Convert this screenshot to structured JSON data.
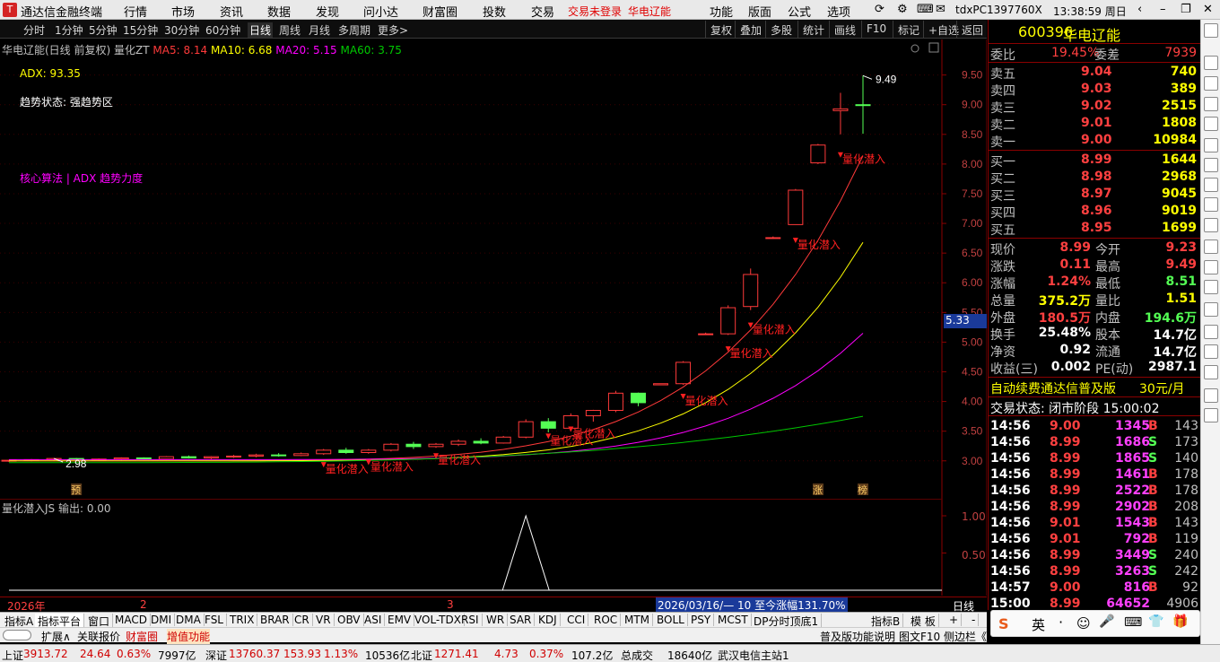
{
  "titlebar": {
    "app_name": "通达信金融终端",
    "menus": [
      "行情",
      "市场",
      "资讯",
      "数据",
      "发现",
      "问小达",
      "财富圈",
      "投数",
      "交易"
    ],
    "login_status": "交易未登录",
    "stock_name": "华电辽能",
    "menus2": [
      "功能",
      "版面",
      "公式",
      "选项"
    ],
    "pc_id": "tdxPC1397760X",
    "clock": "13:38:59 周日"
  },
  "periods": [
    "分时",
    "1分钟",
    "5分钟",
    "15分钟",
    "30分钟",
    "60分钟",
    "日线",
    "周线",
    "月线",
    "多周期",
    "更多>"
  ],
  "active_period": "日线",
  "tools": [
    "复权",
    "叠加",
    "多股",
    "统计",
    "画线",
    "F10",
    "标记",
    "+自选",
    "返回"
  ],
  "chart_header": {
    "title": "华电辽能(日线 前复权)",
    "indicator_name": "量化ZT",
    "ma5": "MA5: 8.14",
    "ma10": "MA10: 6.68",
    "ma20": "MA20: 5.15",
    "ma60": "MA60: 3.75"
  },
  "annotations": {
    "adx": "ADX: 93.35",
    "trend": "趋势状态: 强趋势区",
    "algo": "核心算法 | ADX 趋势力度"
  },
  "price_axis": [
    "9.50",
    "9.00",
    "8.50",
    "8.00",
    "7.50",
    "7.00",
    "6.50",
    "6.00",
    "5.50",
    "5.00",
    "4.50",
    "4.00",
    "3.50",
    "3.00"
  ],
  "current_price_marker": "5.33",
  "chart_labels": {
    "high": "9.49",
    "low": "2.98",
    "signal": "量化潜入",
    "badges": [
      "预",
      "涨",
      "榜"
    ]
  },
  "indicator": {
    "header": "量化潜入JS 输出: 0.00",
    "ticks": [
      "1.00",
      "0.50"
    ]
  },
  "xaxis": {
    "labels": [
      "2026年",
      "2",
      "3"
    ],
    "info": "2026/03/16/— 10 至今涨幅131.70%",
    "period": "日线"
  },
  "chart_data": {
    "type": "candlestick",
    "series": [
      {
        "name": "K线",
        "candles": [
          [
            3.0,
            3.02,
            2.98,
            3.01
          ],
          [
            3.01,
            3.03,
            2.99,
            3.02
          ],
          [
            3.02,
            3.05,
            3.0,
            3.04
          ],
          [
            3.04,
            3.05,
            3.01,
            3.02
          ],
          [
            3.02,
            3.04,
            3.0,
            3.03
          ],
          [
            3.03,
            3.06,
            3.01,
            3.05
          ],
          [
            3.05,
            3.06,
            3.02,
            3.03
          ],
          [
            3.03,
            3.08,
            3.02,
            3.07
          ],
          [
            3.07,
            3.09,
            3.04,
            3.05
          ],
          [
            3.05,
            3.08,
            3.03,
            3.07
          ],
          [
            3.07,
            3.1,
            3.05,
            3.08
          ],
          [
            3.08,
            3.12,
            3.06,
            3.1
          ],
          [
            3.1,
            3.13,
            3.07,
            3.09
          ],
          [
            3.09,
            3.14,
            3.08,
            3.12
          ],
          [
            3.12,
            3.2,
            3.1,
            3.18
          ],
          [
            3.18,
            3.22,
            3.12,
            3.14
          ],
          [
            3.14,
            3.2,
            3.12,
            3.18
          ],
          [
            3.18,
            3.3,
            3.16,
            3.28
          ],
          [
            3.28,
            3.32,
            3.2,
            3.24
          ],
          [
            3.24,
            3.3,
            3.22,
            3.28
          ],
          [
            3.28,
            3.36,
            3.25,
            3.33
          ],
          [
            3.33,
            3.38,
            3.28,
            3.3
          ],
          [
            3.3,
            3.42,
            3.29,
            3.4
          ],
          [
            3.4,
            3.7,
            3.38,
            3.66
          ],
          [
            3.66,
            3.72,
            3.48,
            3.55
          ],
          [
            3.55,
            3.8,
            3.52,
            3.76
          ],
          [
            3.76,
            3.86,
            3.66,
            3.85
          ],
          [
            3.85,
            4.18,
            3.82,
            4.14
          ],
          [
            4.14,
            4.15,
            3.92,
            3.98
          ],
          [
            4.28,
            4.3,
            4.28,
            4.3
          ],
          [
            4.3,
            4.68,
            4.28,
            4.66
          ],
          [
            5.13,
            5.16,
            5.12,
            5.14
          ],
          [
            5.14,
            5.62,
            5.12,
            5.58
          ],
          [
            5.6,
            6.24,
            5.54,
            6.14
          ],
          [
            6.76,
            6.78,
            6.74,
            6.76
          ],
          [
            6.98,
            7.58,
            6.98,
            7.56
          ],
          [
            8.02,
            8.34,
            8.0,
            8.32
          ],
          [
            8.9,
            9.2,
            8.5,
            8.93
          ],
          [
            9.0,
            9.49,
            8.51,
            8.99
          ]
        ]
      },
      {
        "name": "MA5",
        "values": [
          8.14
        ]
      },
      {
        "name": "MA10",
        "values": [
          6.68
        ]
      },
      {
        "name": "MA20",
        "values": [
          5.15
        ]
      },
      {
        "name": "MA60",
        "values": [
          3.75
        ]
      }
    ],
    "ylim": [
      2.8,
      9.6
    ],
    "ytick_labels": [
      "9.50",
      "9.00",
      "8.50",
      "8.00",
      "7.50",
      "7.00",
      "6.50",
      "6.00",
      "5.50",
      "5.00",
      "4.50",
      "4.00",
      "3.50",
      "3.00"
    ],
    "xtick_labels": [
      "2026年",
      "2",
      "3"
    ],
    "signals": [
      {
        "label": "量化潜入",
        "price": 9.49
      },
      {
        "label": "量化潜入",
        "price": 2.98
      }
    ]
  },
  "quote": {
    "code": "600396",
    "name": "华电辽能",
    "weibi_label": "委比",
    "weibi": "19.45%",
    "weicha_label": "委差",
    "weicha": "7939",
    "asks": [
      {
        "label": "卖五",
        "price": "9.04",
        "vol": "740"
      },
      {
        "label": "卖四",
        "price": "9.03",
        "vol": "389"
      },
      {
        "label": "卖三",
        "price": "9.02",
        "vol": "2515"
      },
      {
        "label": "卖二",
        "price": "9.01",
        "vol": "1808"
      },
      {
        "label": "卖一",
        "price": "9.00",
        "vol": "10984"
      }
    ],
    "bids": [
      {
        "label": "买一",
        "price": "8.99",
        "vol": "1644"
      },
      {
        "label": "买二",
        "price": "8.98",
        "vol": "2968"
      },
      {
        "label": "买三",
        "price": "8.97",
        "vol": "9045"
      },
      {
        "label": "买四",
        "price": "8.96",
        "vol": "9019"
      },
      {
        "label": "买五",
        "price": "8.95",
        "vol": "1699"
      }
    ],
    "stats": [
      [
        "现价",
        "8.99",
        "今开",
        "9.23"
      ],
      [
        "涨跌",
        "0.11",
        "最高",
        "9.49"
      ],
      [
        "涨幅",
        "1.24%",
        "最低",
        "8.51"
      ],
      [
        "总量",
        "375.2万",
        "量比",
        "1.51"
      ],
      [
        "外盘",
        "180.5万",
        "内盘",
        "194.6万"
      ],
      [
        "换手",
        "25.48%",
        "股本",
        "14.7亿"
      ],
      [
        "净资",
        "0.92",
        "流通",
        "14.7亿"
      ],
      [
        "收益(三)",
        "0.002",
        "PE(动)",
        "2987.1"
      ]
    ],
    "promo": "自动续费通达信普及版",
    "promo_price": "30元/月",
    "trade_status": "交易状态: 闭市阶段 15:00:02",
    "ticks": [
      [
        "14:56",
        "9.00",
        "1345",
        "B",
        "143"
      ],
      [
        "14:56",
        "8.99",
        "1686",
        "S",
        "173"
      ],
      [
        "14:56",
        "8.99",
        "1865",
        "S",
        "140"
      ],
      [
        "14:56",
        "8.99",
        "1461",
        "B",
        "178"
      ],
      [
        "14:56",
        "8.99",
        "2522",
        "B",
        "178"
      ],
      [
        "14:56",
        "8.99",
        "2902",
        "B",
        "208"
      ],
      [
        "14:56",
        "9.01",
        "1543",
        "B",
        "143"
      ],
      [
        "14:56",
        "9.01",
        "792",
        "B",
        "119"
      ],
      [
        "14:56",
        "8.99",
        "3449",
        "S",
        "240"
      ],
      [
        "14:56",
        "8.99",
        "3263",
        "S",
        "242"
      ],
      [
        "14:57",
        "9.00",
        "816",
        "B",
        "92"
      ],
      [
        "15:00",
        "8.99",
        "64652",
        "",
        "4906"
      ]
    ]
  },
  "tabs1": [
    "指标A",
    "指标平台",
    "窗口",
    "MACD",
    "DMI",
    "DMA",
    "FSL",
    "TRIX",
    "BRAR",
    "CR",
    "VR",
    "OBV",
    "ASI",
    "EMV",
    "VOL-TDX",
    "RSI",
    "WR",
    "SAR",
    "KDJ",
    "CCI",
    "ROC",
    "MTM",
    "BOLL",
    "PSY",
    "MCST",
    "DP分时顶底1"
  ],
  "tabs1_right": [
    "指标B",
    "模 板",
    "+",
    "-"
  ],
  "tabs2": [
    "扩展∧",
    "关联报价",
    "财富圈",
    "增值功能"
  ],
  "tabs2_right": [
    "普及版功能说明",
    "图文F10",
    "侧边栏《"
  ],
  "status": {
    "sh_label": "上证",
    "sh": "3913.72",
    "sh_chg": "24.64",
    "sh_pct": "0.63%",
    "sh_amt": "7997亿",
    "sz_label": "深证",
    "sz": "13760.37",
    "sz_chg": "153.93",
    "sz_pct": "1.13%",
    "sz_amt": "10536亿",
    "bz_label": "北证",
    "bz": "1271.41",
    "bz_chg": "4.73",
    "bz_pct": "0.37%",
    "bz_amt": "107.2亿",
    "total_label": "总成交",
    "total": "18640亿",
    "server": "武汉电信主站1"
  },
  "ime": {
    "lang": "英",
    "items": [
      "·",
      "☺",
      "🎤",
      "⌨",
      "👕",
      "🎁"
    ]
  },
  "colors": {
    "up": "#ff3a3a",
    "down": "#54ff54",
    "ma5": "#ffffff",
    "ma10": "#ffff00",
    "ma20": "#ff00ff",
    "ma60": "#00c800",
    "accent_yellow": "#ffff00"
  }
}
